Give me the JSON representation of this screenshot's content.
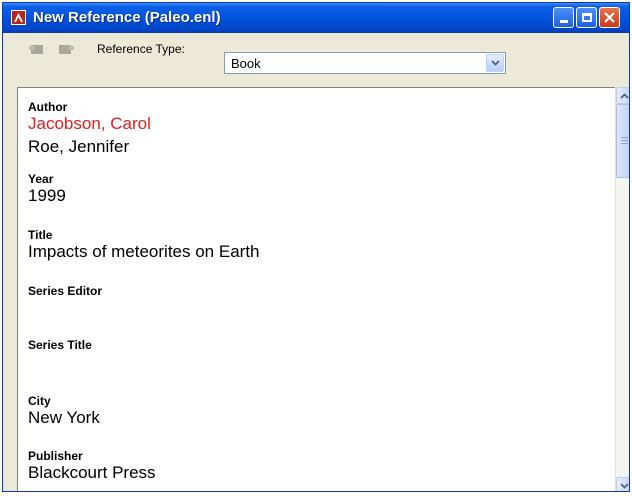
{
  "window": {
    "title": "New Reference (Paleo.enl)"
  },
  "toolbar": {
    "reference_type_label": "Reference Type:",
    "reference_type_value": "Book"
  },
  "fields": [
    {
      "label": "Author",
      "values": [
        {
          "text": "Jacobson, Carol",
          "color": "#e81c1c"
        },
        {
          "text": "Roe, Jennifer",
          "color": "#000000"
        }
      ]
    },
    {
      "label": "Year",
      "values": [
        {
          "text": "1999",
          "color": "#000000"
        }
      ]
    },
    {
      "label": "Title",
      "values": [
        {
          "text": "Impacts of meteorites on Earth",
          "color": "#000000"
        }
      ]
    },
    {
      "label": "Series Editor",
      "values": []
    },
    {
      "label": "Series Title",
      "values": []
    },
    {
      "label": "City",
      "values": [
        {
          "text": "New York",
          "color": "#000000"
        }
      ]
    },
    {
      "label": "Publisher",
      "values": [
        {
          "text": "Blackcourt Press",
          "color": "#000000"
        }
      ]
    }
  ],
  "colors": {
    "titlebar": "#0353dd",
    "highlight_author": "#e81c1c"
  },
  "icons": [
    "app-icon",
    "minimize-icon",
    "maximize-icon",
    "close-icon",
    "back-icon",
    "forward-icon",
    "chevron-down-icon",
    "scroll-up-icon",
    "scroll-down-icon"
  ]
}
